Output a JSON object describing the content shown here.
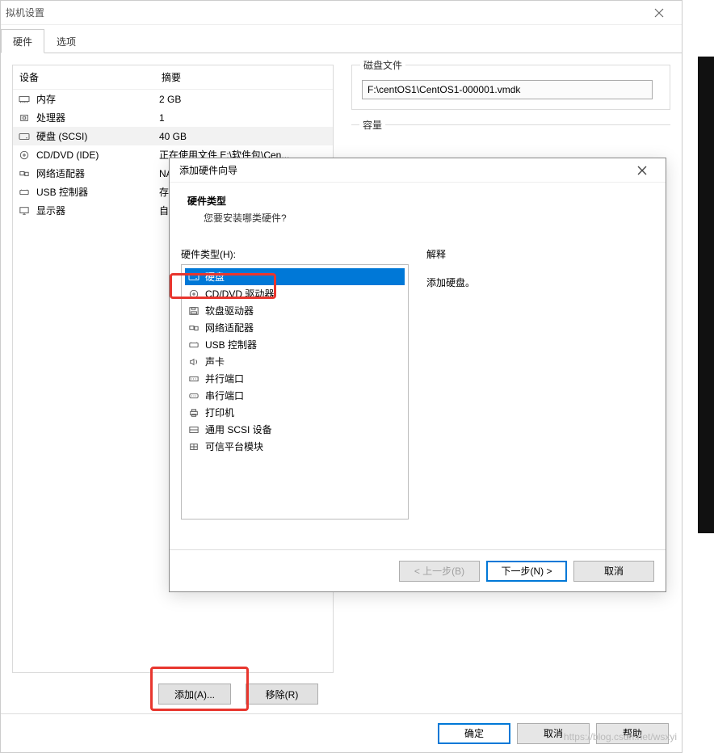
{
  "parent": {
    "title": "拟机设置",
    "tabs": {
      "hardware": "硬件",
      "options": "选项"
    },
    "device_header": {
      "device": "设备",
      "summary": "摘要"
    },
    "devices": [
      {
        "icon": "memory",
        "name": "内存",
        "summary": "2 GB",
        "selected": false
      },
      {
        "icon": "cpu",
        "name": "处理器",
        "summary": "1",
        "selected": false
      },
      {
        "icon": "disk",
        "name": "硬盘 (SCSI)",
        "summary": "40 GB",
        "selected": true
      },
      {
        "icon": "cd",
        "name": "CD/DVD (IDE)",
        "summary": "正在使用文件 E:\\软件包\\Cen...",
        "selected": false
      },
      {
        "icon": "net",
        "name": "网络适配器",
        "summary": "NA",
        "selected": false
      },
      {
        "icon": "usb",
        "name": "USB 控制器",
        "summary": "存",
        "selected": false
      },
      {
        "icon": "display",
        "name": "显示器",
        "summary": "自",
        "selected": false
      }
    ],
    "buttons": {
      "add": "添加(A)...",
      "remove": "移除(R)"
    }
  },
  "disk_group": {
    "legend": "磁盘文件",
    "path": "F:\\centOS1\\CentOS1-000001.vmdk"
  },
  "capacity_group": {
    "legend": "容量"
  },
  "wizard": {
    "title": "添加硬件向导",
    "heading": "硬件类型",
    "subheading": "您要安装哪类硬件?",
    "list_label": "硬件类型(H):",
    "items": [
      {
        "icon": "disk",
        "label": "硬盘",
        "selected": true
      },
      {
        "icon": "cd",
        "label": "CD/DVD 驱动器"
      },
      {
        "icon": "floppy",
        "label": "软盘驱动器"
      },
      {
        "icon": "net",
        "label": "网络适配器"
      },
      {
        "icon": "usb",
        "label": "USB 控制器"
      },
      {
        "icon": "sound",
        "label": "声卡"
      },
      {
        "icon": "parallel",
        "label": "并行端口"
      },
      {
        "icon": "serial",
        "label": "串行端口"
      },
      {
        "icon": "printer",
        "label": "打印机"
      },
      {
        "icon": "scsi",
        "label": "通用 SCSI 设备"
      },
      {
        "icon": "tpm",
        "label": "可信平台模块"
      }
    ],
    "explain_label": "解释",
    "explain_text": "添加硬盘。",
    "buttons": {
      "back": "< 上一步(B)",
      "next": "下一步(N) >",
      "cancel": "取消"
    }
  },
  "main_buttons": {
    "ok": "确定",
    "cancel": "取消",
    "help": "帮助"
  },
  "watermark": "https://blog.csdn.net/wsxyi"
}
